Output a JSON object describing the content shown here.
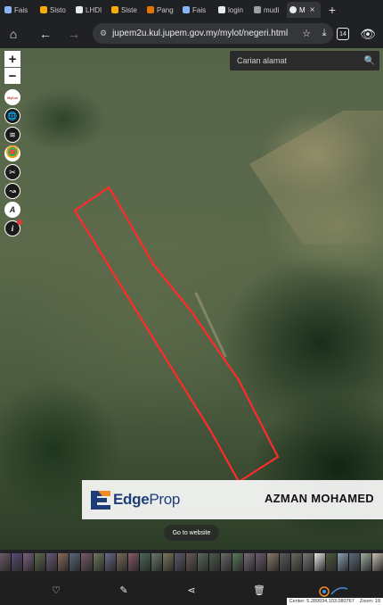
{
  "browser": {
    "tabs": [
      {
        "label": "Fais",
        "color": "#8ab4f8"
      },
      {
        "label": "Sisto",
        "color": "#f9ab00"
      },
      {
        "label": "LHDI",
        "color": "#e8eaed"
      },
      {
        "label": "Siste",
        "color": "#f9ab00"
      },
      {
        "label": "Pang",
        "color": "#e37400"
      },
      {
        "label": "Fais",
        "color": "#8ab4f8"
      },
      {
        "label": "login",
        "color": "#e8eaed"
      },
      {
        "label": "mudi",
        "color": "#9aa0a6"
      },
      {
        "label": "M",
        "color": "#e8eaed",
        "active": true
      }
    ],
    "new_tab": "+",
    "url": "jupem2u.kul.jupem.gov.my/mylot/negeri.html",
    "tab_count": "14"
  },
  "map": {
    "controls": {
      "zoom_in": "+",
      "zoom_out": "−",
      "tools": [
        {
          "name": "mylot-logo-icon",
          "glyph": "MyLot"
        },
        {
          "name": "globe-icon",
          "glyph": "🌐"
        },
        {
          "name": "layers-icon",
          "glyph": "≋"
        },
        {
          "name": "pin-icon",
          "glyph": "●"
        },
        {
          "name": "ruler-icon",
          "glyph": "✂"
        },
        {
          "name": "route-icon",
          "glyph": "↝"
        },
        {
          "name": "text-tool-icon",
          "glyph": "A"
        },
        {
          "name": "info-icon",
          "glyph": "i"
        }
      ]
    },
    "search_placeholder": "Carian alamat",
    "parcel_color": "#ff2a2a"
  },
  "banner": {
    "brand_edge": "Edge",
    "brand_prop": "Prop",
    "agent_name": "AZMAN MOHAMED"
  },
  "goto_label": "Go to website",
  "thumb_colors": [
    "#6b5a6a",
    "#5a4c7a",
    "#7a6080",
    "#5c6b4a",
    "#6a5a7a",
    "#8a6a5a",
    "#5a6a7a",
    "#7a5a6a",
    "#6b7a5a",
    "#6a6a8a",
    "#7a6a5a",
    "#8a5a6a",
    "#4a6a5a",
    "#6a7a6a",
    "#7a7a5a",
    "#5a5a6a",
    "#6a5a5a",
    "#5a6a5a",
    "#4a5a4a",
    "#6a6a6a",
    "#5a7a5a",
    "#7a6a7a",
    "#6a5a6a",
    "#8a7a6a",
    "#5a5a5a",
    "#6a6a5a",
    "#7a7a7a",
    "#e8e8e8",
    "#4a5a3a",
    "#8aa0b8",
    "#5a6a7a",
    "#a0b0a0",
    "#c8c0b0"
  ],
  "bottom": {
    "status_center": "Center: 5.289934,103.080767",
    "status_zoom": "Zoom: 18"
  }
}
